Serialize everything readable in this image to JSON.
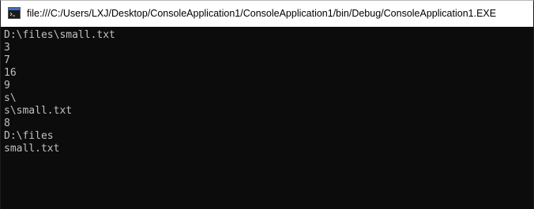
{
  "window": {
    "title": "file:///C:/Users/LXJ/Desktop/ConsoleApplication1/ConsoleApplication1/bin/Debug/ConsoleApplication1.EXE",
    "icon": "console-app-icon"
  },
  "console": {
    "background_color": "#0c0c0c",
    "text_color": "#c0c0c0",
    "lines": [
      "D:\\files\\small.txt",
      "3",
      "7",
      "16",
      "9",
      "s\\",
      "s\\small.txt",
      "8",
      "D:\\files",
      "small.txt"
    ]
  }
}
